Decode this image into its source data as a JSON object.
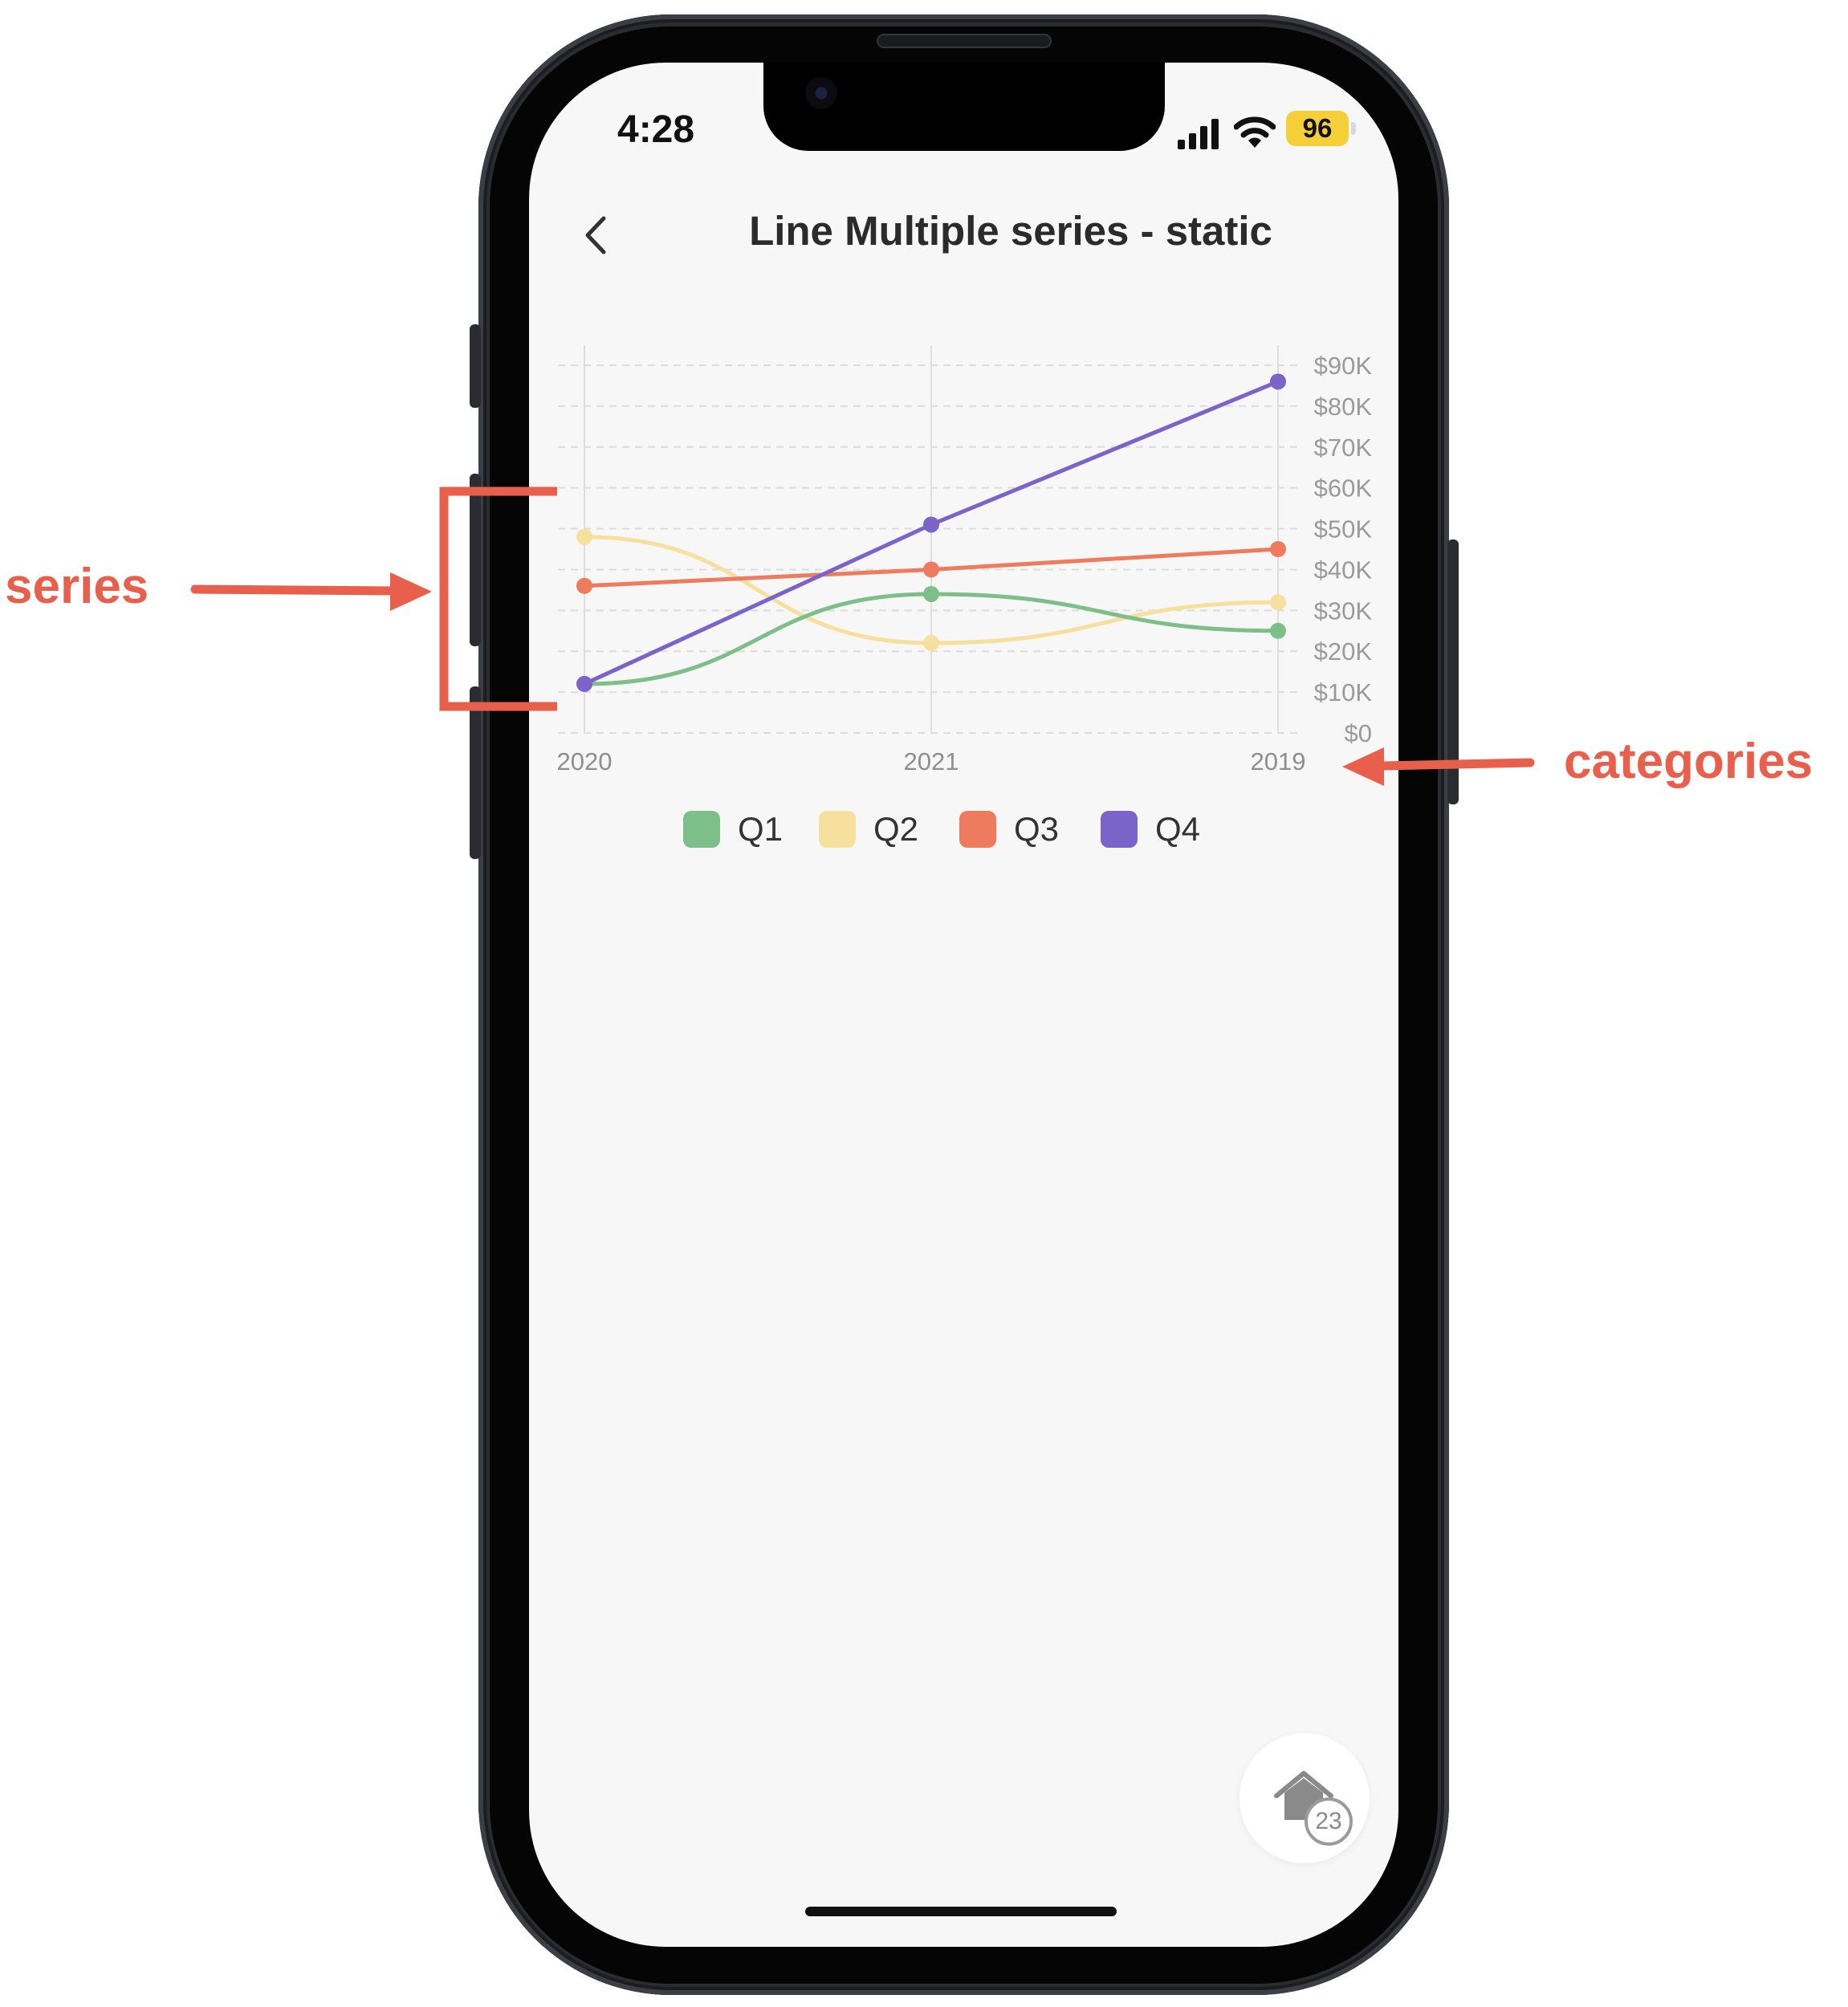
{
  "status_bar": {
    "time": "4:28",
    "battery": "96"
  },
  "header": {
    "title": "Line Multiple series - static"
  },
  "chart_data": {
    "type": "line",
    "categories": [
      "2020",
      "2021",
      "2019"
    ],
    "series": [
      {
        "name": "Q1",
        "color": "#7dbf88",
        "values": [
          12000,
          34000,
          25000
        ]
      },
      {
        "name": "Q2",
        "color": "#f7df9d",
        "values": [
          48000,
          22000,
          32000
        ]
      },
      {
        "name": "Q3",
        "color": "#ee7b5e",
        "values": [
          36000,
          40000,
          45000
        ]
      },
      {
        "name": "Q4",
        "color": "#7b63c9",
        "values": [
          12000,
          51000,
          86000
        ]
      }
    ],
    "y_ticks": [
      "$0",
      "$10K",
      "$20K",
      "$30K",
      "$40K",
      "$50K",
      "$60K",
      "$70K",
      "$80K",
      "$90K"
    ],
    "ylim": [
      0,
      90000
    ],
    "y_axis_position": "right",
    "grid": true,
    "legend_position": "bottom"
  },
  "fab": {
    "badge": "23",
    "icon": "home-icon"
  },
  "annotations": {
    "series_label": "series",
    "categories_label": "categories",
    "color": "#e8604c"
  }
}
